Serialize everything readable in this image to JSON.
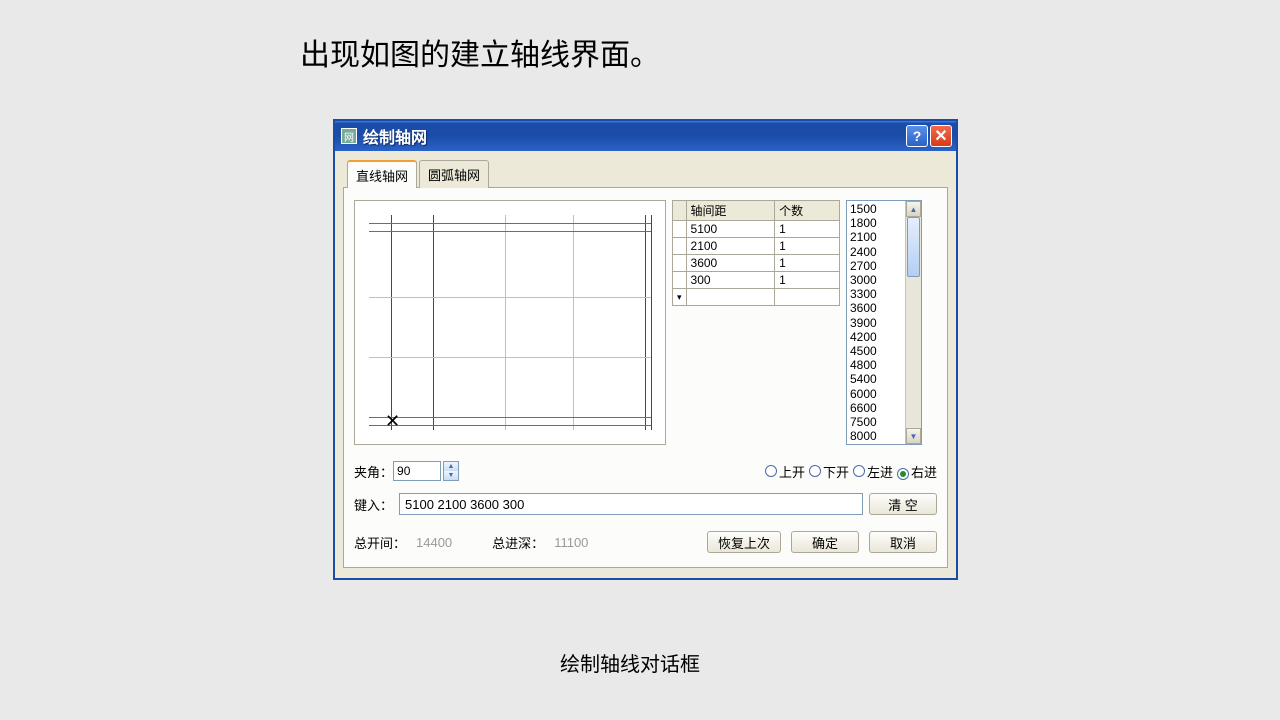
{
  "page": {
    "heading": "出现如图的建立轴线界面。",
    "caption": "绘制轴线对话框"
  },
  "dialog": {
    "title": "绘制轴网",
    "tabs": {
      "straight": "直线轴网",
      "arc": "圆弧轴网"
    },
    "axis_table": {
      "col_spacing": "轴间距",
      "col_count": "个数",
      "rows": [
        {
          "spacing": "5100",
          "count": "1"
        },
        {
          "spacing": "2100",
          "count": "1"
        },
        {
          "spacing": "3600",
          "count": "1"
        },
        {
          "spacing": "300",
          "count": "1"
        }
      ]
    },
    "spacing_list": [
      "1500",
      "1800",
      "2100",
      "2400",
      "2700",
      "3000",
      "3300",
      "3600",
      "3900",
      "4200",
      "4500",
      "4800",
      "5400",
      "6000",
      "6600",
      "7500",
      "8000"
    ],
    "angle_label": "夹角：",
    "angle_value": "90",
    "direction": {
      "up": "上开",
      "down": "下开",
      "left": "左进",
      "right": "右进"
    },
    "key_label": "键入：",
    "key_value": "5100 2100 3600 300",
    "clear_label": "清  空",
    "footer": {
      "total_open_label": "总开间：",
      "total_open_value": "14400",
      "total_depth_label": "总进深：",
      "total_depth_value": "11100",
      "restore_label": "恢复上次",
      "ok_label": "确定",
      "cancel_label": "取消"
    }
  }
}
